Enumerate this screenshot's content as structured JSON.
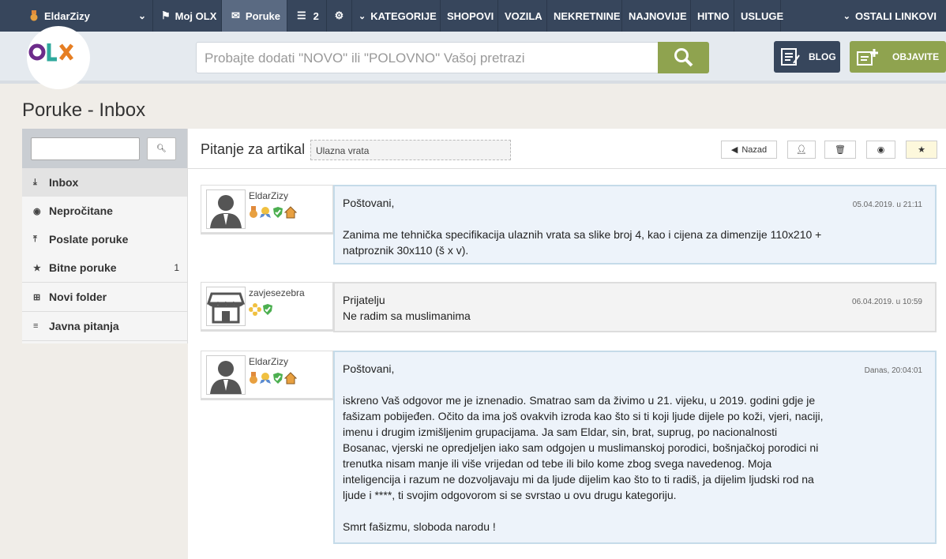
{
  "topnav": {
    "user": "EldarZizy",
    "moj_olx": "Moj OLX",
    "poruke": "Poruke",
    "count": "2",
    "kategorije": "KATEGORIJE",
    "shopovi": "SHOPOVI",
    "vozila": "VOZILA",
    "nekretnine": "NEKRETNINE",
    "najnovije": "NAJNOVIJE",
    "hitno": "HITNO",
    "usluge": "USLUGE",
    "ostali": "OSTALI LINKOVI"
  },
  "header": {
    "search_placeholder": "Probajte dodati \"NOVO\" ili \"POLOVNO\" Vašoj pretrazi",
    "blog": "BLOG",
    "objavite": "OBJAVITE"
  },
  "page_title": "Poruke - Inbox",
  "sidebar": {
    "items": [
      {
        "label": "Inbox"
      },
      {
        "label": "Nepročitane"
      },
      {
        "label": "Poslate poruke"
      },
      {
        "label": "Bitne poruke",
        "count": "1"
      },
      {
        "label": "Novi folder"
      },
      {
        "label": "Javna pitanja"
      }
    ]
  },
  "thread": {
    "title": "Pitanje za artikal",
    "subject": "Ulazna vrata",
    "back": "Nazad"
  },
  "messages": [
    {
      "user": "EldarZizy",
      "date": "05.04.2019. u 21:11",
      "greeting": "Poštovani,",
      "body": "Zanima me tehnička specifikacija ulaznih vrata sa slike broj 4, kao i cijena za dimenzije 110x210 + natproznik 30x110 (š x v)."
    },
    {
      "user": "zavjesezebra",
      "date": "06.04.2019. u 10:59",
      "greeting": "Prijatelju",
      "body": "Ne radim sa muslimanima"
    },
    {
      "user": "EldarZizy",
      "date": "Danas, 20:04:01",
      "greeting": "Poštovani,",
      "body": "iskreno Vaš odgovor me je iznenadio. Smatrao sam da živimo u 21. vijeku, u 2019. godini gdje je fašizam pobijeđen. Očito da ima još ovakvih izroda kao što si ti koji ljude dijele po koži, vjeri, naciji, imenu i drugim izmišljenim grupacijama. Ja sam Eldar, sin, brat, suprug, po nacionalnosti Bosanac, vjerski ne opredjeljen iako sam odgojen u muslimanskoj porodici, bošnjačkoj porodici ni trenutka nisam manje ili više vrijedan od tebe ili bilo kome zbog svega navedenog. Moja inteligencija i razum ne dozvoljavaju mi da ljude dijelim kao što to ti radiš, ja dijelim ljudski rod na ljude i ****, ti svojim odgovorom si se svrstao u ovu drugu kategoriju.",
      "closing": "Smrt fašizmu, sloboda narodu !"
    }
  ],
  "logo_text": "OLX",
  "colors": {
    "nav": "#37465c",
    "accent_green": "#8fa34f",
    "bubble_blue": "#edf3fa"
  }
}
